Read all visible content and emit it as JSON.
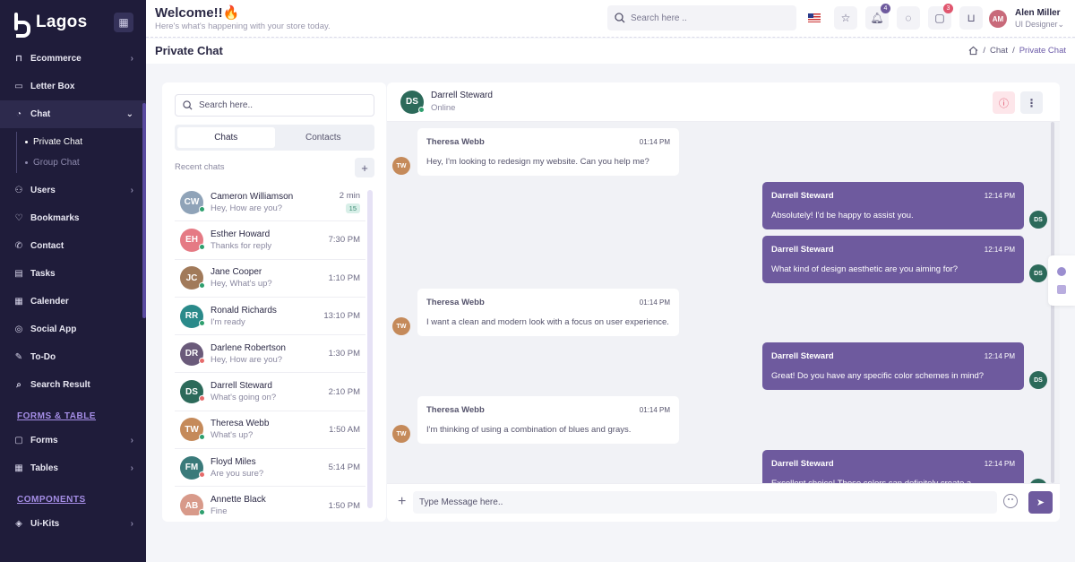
{
  "brand": {
    "name": "Lagos"
  },
  "sidebar": {
    "items": [
      {
        "label": "Ecommerce",
        "icon": "bag-icon",
        "chevron": "›"
      },
      {
        "label": "Letter Box",
        "icon": "inbox-icon",
        "chevron": ""
      },
      {
        "label": "Chat",
        "icon": "chat-icon",
        "chevron": "⌄"
      },
      {
        "label": "Users",
        "icon": "users-icon",
        "chevron": "›"
      },
      {
        "label": "Bookmarks",
        "icon": "heart-icon",
        "chevron": ""
      },
      {
        "label": "Contact",
        "icon": "phone-icon",
        "chevron": ""
      },
      {
        "label": "Tasks",
        "icon": "clipboard-icon",
        "chevron": ""
      },
      {
        "label": "Calender",
        "icon": "calendar-icon",
        "chevron": ""
      },
      {
        "label": "Social App",
        "icon": "globe-icon",
        "chevron": ""
      },
      {
        "label": "To-Do",
        "icon": "pen-icon",
        "chevron": ""
      },
      {
        "label": "Search Result",
        "icon": "search-icon",
        "chevron": ""
      }
    ],
    "chat_sub": [
      {
        "label": "Private Chat"
      },
      {
        "label": "Group Chat"
      }
    ],
    "section_forms": "FORMS & TABLE",
    "forms_items": [
      {
        "label": "Forms",
        "chevron": "›"
      },
      {
        "label": "Tables",
        "chevron": "›"
      }
    ],
    "section_components": "COMPONENTS",
    "component_items": [
      {
        "label": "Ui-Kits",
        "chevron": "›"
      }
    ]
  },
  "header": {
    "welcome_title": "Welcome!!",
    "welcome_sub": "Here's what's happening with your store today.",
    "search_placeholder": "Search here ..",
    "notif_count": "4",
    "cart_count": "3",
    "user_name": "Alen Miller",
    "user_role": "UI Designer",
    "user_role_chevron": "⌄"
  },
  "page": {
    "title": "Private Chat",
    "breadcrumb": [
      "Chat",
      "Private Chat"
    ],
    "sep": "/"
  },
  "chat_list": {
    "search_placeholder": "Search here..",
    "tabs": [
      "Chats",
      "Contacts"
    ],
    "recent_label": "Recent chats",
    "contacts": [
      {
        "name": "Cameron Williamson",
        "msg": "Hey, How are you?",
        "time": "2 min",
        "badge": "15",
        "status": "#2e9f6e",
        "color": "#8fa3b8"
      },
      {
        "name": "Esther Howard",
        "msg": "Thanks for reply",
        "time": "7:30 PM",
        "badge": "",
        "status": "#2e9f6e",
        "color": "#e57a84"
      },
      {
        "name": "Jane Cooper",
        "msg": "Hey, What's up?",
        "time": "1:10 PM",
        "badge": "",
        "status": "#2e9f6e",
        "color": "#a17a5a"
      },
      {
        "name": "Ronald Richards",
        "msg": "I'm ready",
        "time": "13:10 PM",
        "badge": "",
        "status": "#2e9f6e",
        "color": "#2a8a8a"
      },
      {
        "name": "Darlene Robertson",
        "msg": "Hey, How are you?",
        "time": "1:30 PM",
        "badge": "",
        "status": "#e66b6b",
        "color": "#6a5a7a"
      },
      {
        "name": "Darrell Steward",
        "msg": "What's going on?",
        "time": "2:10 PM",
        "badge": "",
        "status": "#e66b6b",
        "color": "#2c6a5a"
      },
      {
        "name": "Theresa Webb",
        "msg": "What's up?",
        "time": "1:50 AM",
        "badge": "",
        "status": "#2e9f6e",
        "color": "#c58a5a"
      },
      {
        "name": "Floyd Miles",
        "msg": "Are you sure?",
        "time": "5:14 PM",
        "badge": "",
        "status": "#e66b6b",
        "color": "#3a7a7a"
      },
      {
        "name": "Annette Black",
        "msg": "Fine",
        "time": "1:50 PM",
        "badge": "",
        "status": "#2e9f6e",
        "color": "#d89a8a"
      }
    ]
  },
  "chat": {
    "contact_name": "Darrell Steward",
    "contact_status": "Online",
    "messages": [
      {
        "dir": "in",
        "name": "Theresa Webb",
        "time": "01:14 PM",
        "text": "Hey, I'm looking to redesign my website. Can you help me?"
      },
      {
        "dir": "out",
        "name": "Darrell Steward",
        "time": "12:14 PM",
        "text": "Absolutely! I'd be happy to assist you."
      },
      {
        "dir": "out",
        "name": "Darrell Steward",
        "time": "12:14 PM",
        "text": "What kind of design aesthetic are you aiming for?"
      },
      {
        "dir": "in",
        "name": "Theresa Webb",
        "time": "01:14 PM",
        "text": "I want a clean and modern look with a focus on user experience."
      },
      {
        "dir": "out",
        "name": "Darrell Steward",
        "time": "12:14 PM",
        "text": "Great! Do you have any specific color schemes in mind?"
      },
      {
        "dir": "in",
        "name": "Theresa Webb",
        "time": "01:14 PM",
        "text": "I'm thinking of using a combination of blues and grays."
      },
      {
        "dir": "out",
        "name": "Darrell Steward",
        "time": "12:14 PM",
        "text": "Excellent choice! Those colors can definitely create a"
      }
    ],
    "input_placeholder": "Type Message here.."
  },
  "colors": {
    "accent": "#6e5a9e",
    "sidebar": "#1f1c3a",
    "online": "#2e9f6e",
    "offline": "#e66b6b"
  }
}
